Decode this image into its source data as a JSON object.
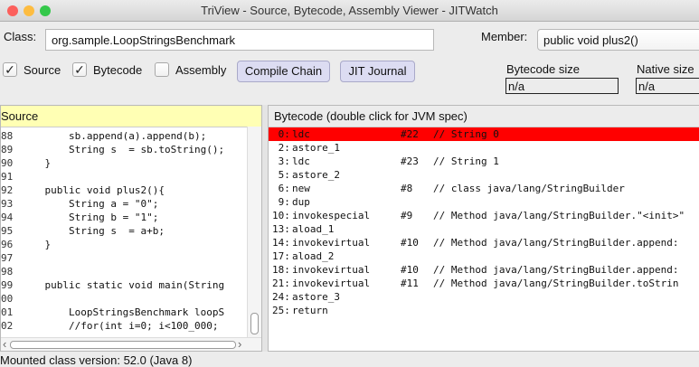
{
  "window": {
    "title": "TriView - Source, Bytecode, Assembly Viewer - JITWatch",
    "close_color": "#fc605c",
    "minimize_color": "#fdbc40",
    "maximize_color": "#34c84a"
  },
  "toolbar": {
    "class_label": "Class:",
    "class_value": "org.sample.LoopStringsBenchmark",
    "member_label": "Member:",
    "member_value": "public void plus2()",
    "source_label": "Source",
    "source_checked": true,
    "bytecode_label": "Bytecode",
    "bytecode_checked": true,
    "assembly_label": "Assembly",
    "assembly_checked": false,
    "compile_chain_label": "Compile Chain",
    "jit_journal_label": "JIT Journal",
    "bytecode_size_label": "Bytecode size",
    "bytecode_size_value": "n/a",
    "native_size_label": "Native size",
    "native_size_value": "n/a"
  },
  "source": {
    "header": "Source",
    "header_color": "#ffffb4",
    "lines": [
      {
        "num": "88",
        "code": "        sb.append(a).append(b);"
      },
      {
        "num": "89",
        "code": "        String s  = sb.toString();"
      },
      {
        "num": "90",
        "code": "    }"
      },
      {
        "num": "91",
        "code": ""
      },
      {
        "num": "92",
        "code": "    public void plus2(){"
      },
      {
        "num": "93",
        "code": "        String a = \"0\";"
      },
      {
        "num": "94",
        "code": "        String b = \"1\";"
      },
      {
        "num": "95",
        "code": "        String s  = a+b;"
      },
      {
        "num": "96",
        "code": "    }"
      },
      {
        "num": "97",
        "code": ""
      },
      {
        "num": "98",
        "code": ""
      },
      {
        "num": "99",
        "code": "    public static void main(String"
      },
      {
        "num": "00",
        "code": ""
      },
      {
        "num": "01",
        "code": "        LoopStringsBenchmark loopS"
      },
      {
        "num": "02",
        "code": "        //for(int i=0; i<100_000;"
      }
    ]
  },
  "bytecode": {
    "header": "Bytecode (double click for JVM spec)",
    "highlight_color": "#ff0000",
    "lines": [
      {
        "offset": " 0:",
        "op": "ldc",
        "arg": "#22",
        "comment": "// String 0",
        "highlighted": true
      },
      {
        "offset": " 2:",
        "op": "astore_1",
        "arg": "",
        "comment": "",
        "highlighted": false
      },
      {
        "offset": " 3:",
        "op": "ldc",
        "arg": "#23",
        "comment": "// String 1",
        "highlighted": false
      },
      {
        "offset": " 5:",
        "op": "astore_2",
        "arg": "",
        "comment": "",
        "highlighted": false
      },
      {
        "offset": " 6:",
        "op": "new",
        "arg": "#8",
        "comment": "// class java/lang/StringBuilder",
        "highlighted": false
      },
      {
        "offset": " 9:",
        "op": "dup",
        "arg": "",
        "comment": "",
        "highlighted": false
      },
      {
        "offset": "10:",
        "op": "invokespecial",
        "arg": "#9",
        "comment": "// Method java/lang/StringBuilder.\"<init>\"",
        "highlighted": false
      },
      {
        "offset": "13:",
        "op": "aload_1",
        "arg": "",
        "comment": "",
        "highlighted": false
      },
      {
        "offset": "14:",
        "op": "invokevirtual",
        "arg": "#10",
        "comment": "// Method java/lang/StringBuilder.append:",
        "highlighted": false
      },
      {
        "offset": "17:",
        "op": "aload_2",
        "arg": "",
        "comment": "",
        "highlighted": false
      },
      {
        "offset": "18:",
        "op": "invokevirtual",
        "arg": "#10",
        "comment": "// Method java/lang/StringBuilder.append:",
        "highlighted": false
      },
      {
        "offset": "21:",
        "op": "invokevirtual",
        "arg": "#11",
        "comment": "// Method java/lang/StringBuilder.toStrin",
        "highlighted": false
      },
      {
        "offset": "24:",
        "op": "astore_3",
        "arg": "",
        "comment": "",
        "highlighted": false
      },
      {
        "offset": "25:",
        "op": "return",
        "arg": "",
        "comment": "",
        "highlighted": false
      }
    ]
  },
  "status": {
    "text": "Mounted class version: 52.0 (Java 8)"
  },
  "icons": {
    "checkmark": "✓",
    "scroll_left": "‹",
    "scroll_right": "›"
  }
}
